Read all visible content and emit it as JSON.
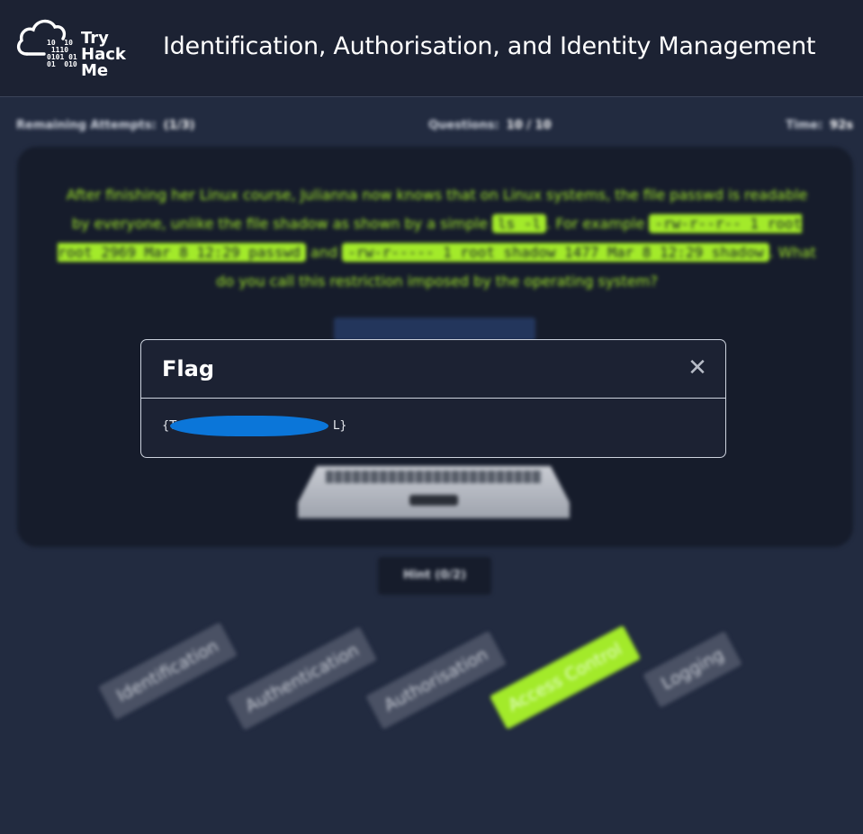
{
  "header": {
    "logo_bits": "10  10\n 1110\n0101 01\n01  010",
    "logo_words": [
      "Try",
      "Hack",
      "Me"
    ],
    "title": "Identification, Authorisation, and Identity Management"
  },
  "stats": {
    "remaining_label": "Remaining Attempts:",
    "remaining_value": "(1/3)",
    "questions_label": "Questions:",
    "questions_value": "10 / 10",
    "time_label": "Time:",
    "time_value": "92s"
  },
  "question": {
    "part1": "After finishing her Linux course, Julianna now knows that on Linux systems, the file passwd is readable by everyone, unlike the file shadow as shown by a simple ",
    "code1": "ls -l",
    "part2": ". For example ",
    "code2": "-rw-r--r-- 1 root root 2969 Mar 8 12:29 passwd",
    "part3": " and ",
    "code3": "-rw-r----- 1 root shadow 1477 Mar 8 12:29 shadow",
    "part4": ". What do you call this restriction imposed by the operating system?"
  },
  "hint_button": "Hint (0/2)",
  "tags": [
    {
      "label": "Identification",
      "active": false
    },
    {
      "label": "Authentication",
      "active": false
    },
    {
      "label": "Authorisation",
      "active": false
    },
    {
      "label": "Access Control",
      "active": true
    },
    {
      "label": "Logging",
      "active": false
    }
  ],
  "modal": {
    "title": "Flag",
    "close_glyph": "✕",
    "flag_start": "{T",
    "flag_end": "L}"
  },
  "colors": {
    "accent": "#a3ea2a",
    "background": "#222b40",
    "header": "#1c2233",
    "redaction": "#0b76d9"
  }
}
